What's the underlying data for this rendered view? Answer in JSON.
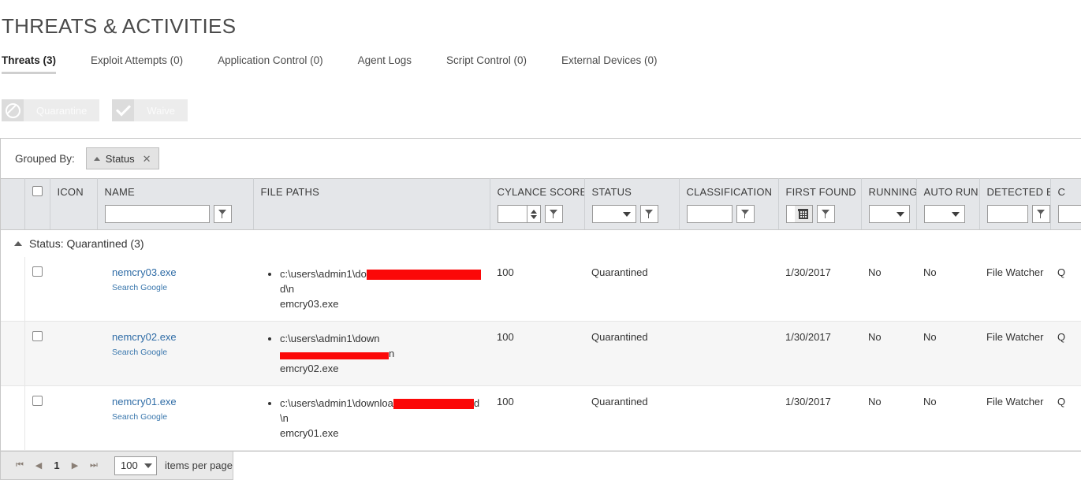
{
  "header": {
    "title": "THREATS & ACTIVITIES"
  },
  "tabs": [
    {
      "label": "Threats (3)",
      "active": true
    },
    {
      "label": "Exploit Attempts (0)",
      "active": false
    },
    {
      "label": "Application Control (0)",
      "active": false
    },
    {
      "label": "Agent Logs",
      "active": false
    },
    {
      "label": "Script Control (0)",
      "active": false
    },
    {
      "label": "External Devices (0)",
      "active": false
    }
  ],
  "toolbar": {
    "quarantine_label": "Quarantine",
    "quarantine_icon": "ban-icon",
    "waive_label": "Waive",
    "waive_icon": "check-icon",
    "disabled": true
  },
  "grouping": {
    "label": "Grouped By:",
    "chip_label": "Status",
    "chip_sort": "ascending",
    "chip_remove_icon": "close-icon"
  },
  "table": {
    "columns": [
      {
        "key": "icon",
        "label": "ICON",
        "filter": "none"
      },
      {
        "key": "name",
        "label": "NAME",
        "filter": "text"
      },
      {
        "key": "file_paths",
        "label": "FILE PATHS",
        "filter": "none"
      },
      {
        "key": "cylance_score",
        "label": "CYLANCE SCORE",
        "filter": "spinner"
      },
      {
        "key": "status",
        "label": "STATUS",
        "filter": "select"
      },
      {
        "key": "classification",
        "label": "CLASSIFICATION",
        "filter": "text"
      },
      {
        "key": "first_found",
        "label": "FIRST FOUND",
        "filter": "date"
      },
      {
        "key": "running",
        "label": "RUNNING",
        "filter": "select-only"
      },
      {
        "key": "auto_run",
        "label": "AUTO RUN...",
        "filter": "select-only"
      },
      {
        "key": "detected_by",
        "label": "DETECTED BY",
        "filter": "text"
      },
      {
        "key": "cut_off",
        "label": "C",
        "filter": "text"
      }
    ],
    "filter_values": {
      "name": "",
      "cylance_score": "",
      "status": "",
      "classification": "",
      "first_found": "",
      "running": "",
      "auto_run": "",
      "detected_by": ""
    },
    "group_header": "Status: Quarantined (3)",
    "rows": [
      {
        "name": "nemcry03.exe",
        "sub_link": "Search Google",
        "path_prefix": "c:\\users\\admin1\\do",
        "redact_width": 145,
        "path_suffix": "d\\n",
        "path_line2": "emcry03.exe",
        "cylance_score": "100",
        "status": "Quarantined",
        "classification": "",
        "first_found": "1/30/2017",
        "running": "No",
        "auto_run": "No",
        "detected_by": "File Watcher",
        "cut_off": "Q"
      },
      {
        "name": "nemcry02.exe",
        "sub_link": "Search Google",
        "path_prefix": "c:\\users\\admin1\\down",
        "redact_width": 138,
        "path_suffix": "n",
        "path_line2": "emcry02.exe",
        "cylance_score": "100",
        "status": "Quarantined",
        "classification": "",
        "first_found": "1/30/2017",
        "running": "No",
        "auto_run": "No",
        "detected_by": "File Watcher",
        "cut_off": "Q"
      },
      {
        "name": "nemcry01.exe",
        "sub_link": "Search Google",
        "path_prefix": "c:\\users\\admin1\\downloa",
        "redact_width": 102,
        "path_suffix": "d\\n",
        "path_line2": "emcry01.exe",
        "cylance_score": "100",
        "status": "Quarantined",
        "classification": "",
        "first_found": "1/30/2017",
        "running": "No",
        "auto_run": "No",
        "detected_by": "File Watcher",
        "cut_off": "Q"
      }
    ]
  },
  "pager": {
    "first_icon": "first-page-icon",
    "prev_icon": "previous-page-icon",
    "page": "1",
    "next_icon": "next-page-icon",
    "last_icon": "last-page-icon",
    "page_size": "100",
    "page_size_label": "items per page"
  },
  "colors": {
    "link": "#2f6ca6",
    "score": "#e03a2f",
    "redaction": "#fb0808",
    "header_bg": "#e4e6e9",
    "tab_underline": "#cfcfcf"
  }
}
